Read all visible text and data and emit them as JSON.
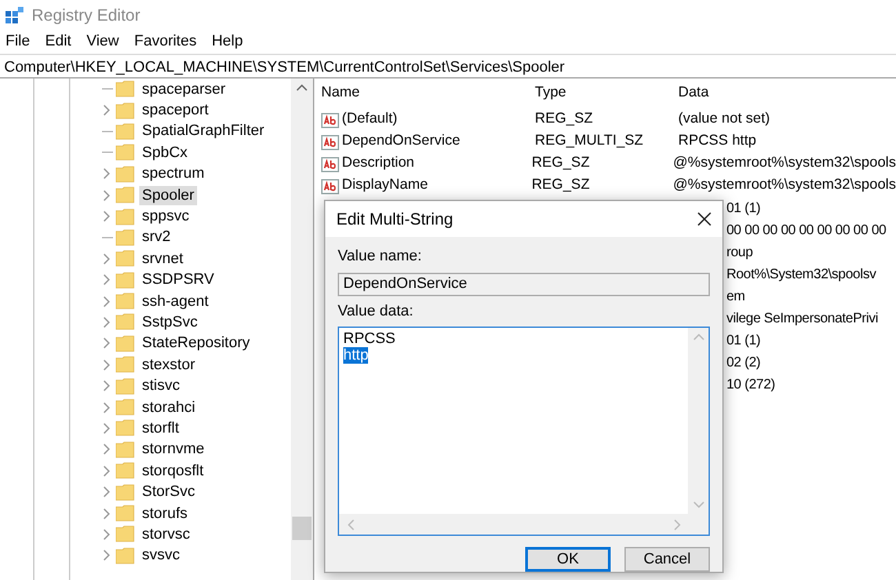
{
  "window": {
    "title": "Registry Editor"
  },
  "menu": [
    "File",
    "Edit",
    "View",
    "Favorites",
    "Help"
  ],
  "address_bar": {
    "value": "Computer\\HKEY_LOCAL_MACHINE\\SYSTEM\\CurrentControlSet\\Services\\Spooler"
  },
  "tree": {
    "items": [
      {
        "label": "spaceparser",
        "expandable": false,
        "selected": false
      },
      {
        "label": "spaceport",
        "expandable": true,
        "selected": false
      },
      {
        "label": "SpatialGraphFilter",
        "expandable": false,
        "selected": false
      },
      {
        "label": "SpbCx",
        "expandable": false,
        "selected": false
      },
      {
        "label": "spectrum",
        "expandable": true,
        "selected": false
      },
      {
        "label": "Spooler",
        "expandable": true,
        "selected": true
      },
      {
        "label": "sppsvc",
        "expandable": true,
        "selected": false
      },
      {
        "label": "srv2",
        "expandable": false,
        "selected": false
      },
      {
        "label": "srvnet",
        "expandable": true,
        "selected": false
      },
      {
        "label": "SSDPSRV",
        "expandable": true,
        "selected": false
      },
      {
        "label": "ssh-agent",
        "expandable": true,
        "selected": false
      },
      {
        "label": "SstpSvc",
        "expandable": true,
        "selected": false
      },
      {
        "label": "StateRepository",
        "expandable": true,
        "selected": false
      },
      {
        "label": "stexstor",
        "expandable": true,
        "selected": false
      },
      {
        "label": "stisvc",
        "expandable": true,
        "selected": false
      },
      {
        "label": "storahci",
        "expandable": true,
        "selected": false
      },
      {
        "label": "storflt",
        "expandable": true,
        "selected": false
      },
      {
        "label": "stornvme",
        "expandable": true,
        "selected": false
      },
      {
        "label": "storqosflt",
        "expandable": true,
        "selected": false
      },
      {
        "label": "StorSvc",
        "expandable": true,
        "selected": false
      },
      {
        "label": "storufs",
        "expandable": true,
        "selected": false
      },
      {
        "label": "storvsc",
        "expandable": true,
        "selected": false
      },
      {
        "label": "svsvc",
        "expandable": true,
        "selected": false
      }
    ]
  },
  "values_table": {
    "columns": [
      "Name",
      "Type",
      "Data"
    ],
    "rows": [
      {
        "kind": "full",
        "name": "(Default)",
        "type": "REG_SZ",
        "data": "(value not set)"
      },
      {
        "kind": "full",
        "name": "DependOnService",
        "type": "REG_MULTI_SZ",
        "data": "RPCSS http"
      },
      {
        "kind": "full",
        "name": "Description",
        "type": "REG_SZ",
        "data": "@%systemroot%\\system32\\spools"
      },
      {
        "kind": "full",
        "name": "DisplayName",
        "type": "REG_SZ",
        "data": "@%systemroot%\\system32\\spools"
      },
      {
        "kind": "covered",
        "data": "01 (1)"
      },
      {
        "kind": "covered",
        "data": "00 00 00 00 00 00 00 00 00"
      },
      {
        "kind": "covered",
        "data": "roup"
      },
      {
        "kind": "covered",
        "data": "Root%\\System32\\spoolsv"
      },
      {
        "kind": "covered",
        "data": "em"
      },
      {
        "kind": "covered",
        "data": "vilege SeImpersonatePrivi"
      },
      {
        "kind": "covered",
        "data": "01 (1)"
      },
      {
        "kind": "covered",
        "data": "02 (2)"
      },
      {
        "kind": "covered",
        "data": "10 (272)"
      }
    ]
  },
  "dialog": {
    "title": "Edit Multi-String",
    "value_name_label": "Value name:",
    "value_name": "DependOnService",
    "value_data_label": "Value data:",
    "value_data_lines": [
      {
        "text": "RPCSS",
        "selected": false
      },
      {
        "text": "http",
        "selected": true
      }
    ],
    "buttons": [
      {
        "label": "OK",
        "default": true
      },
      {
        "label": "Cancel",
        "default": false
      }
    ]
  }
}
